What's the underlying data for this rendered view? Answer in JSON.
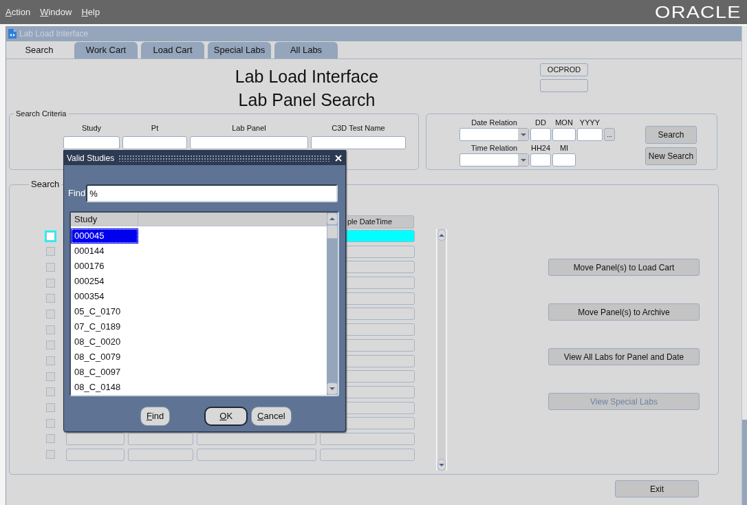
{
  "menu": [
    {
      "label": "Action"
    },
    {
      "label": "Window"
    },
    {
      "label": "Help"
    }
  ],
  "brand": "ORACLE",
  "window": {
    "title": "Lab Load Interface",
    "active": false
  },
  "tabs": [
    {
      "label": "Search",
      "selected": true
    },
    {
      "label": "Work Cart",
      "selected": false
    },
    {
      "label": "Load Cart",
      "selected": false
    },
    {
      "label": "Special Labs",
      "selected": false
    },
    {
      "label": "All Labs",
      "selected": false
    }
  ],
  "heading": [
    "Lab Load Interface",
    "Lab Panel Search"
  ],
  "instance_field": {
    "value": "OCPROD"
  },
  "search_criteria": {
    "title": "Search Criteria",
    "labels": [
      "Study",
      "Pt",
      "Lab Panel",
      "C3D Test Name"
    ]
  },
  "date_filters": {
    "date_relation_label": "Date Relation",
    "date_labels": [
      "DD",
      "MON",
      "YYYY"
    ],
    "lov_button": "...",
    "time_relation_label": "Time Relation",
    "time_labels": [
      "HH24",
      "MI"
    ]
  },
  "search_buttons": [
    "Search",
    "New Search"
  ],
  "results": {
    "title": "Search",
    "visible_header": "ple DateTime",
    "rows": [
      {
        "checked": false,
        "current": true
      },
      {
        "checked": false,
        "current": false
      },
      {
        "checked": false,
        "current": false
      },
      {
        "checked": false,
        "current": false
      },
      {
        "checked": false,
        "current": false
      },
      {
        "checked": false,
        "current": false
      },
      {
        "checked": false,
        "current": false
      },
      {
        "checked": false,
        "current": false
      },
      {
        "checked": false,
        "current": false
      },
      {
        "checked": false,
        "current": false
      },
      {
        "checked": false,
        "current": false
      },
      {
        "checked": false,
        "current": false
      },
      {
        "checked": false,
        "current": false
      },
      {
        "checked": false,
        "current": false
      },
      {
        "checked": false,
        "current": false
      }
    ]
  },
  "actions": [
    {
      "label": "Move Panel(s) to Load Cart",
      "disabled": false
    },
    {
      "label": "Move Panel(s) to Archive",
      "disabled": false
    },
    {
      "label": "View All Labs for Panel and Date",
      "disabled": false
    },
    {
      "label": "View Special Labs",
      "disabled": true
    }
  ],
  "exit_button": "Exit",
  "dialog": {
    "title": "Valid Studies",
    "find_label": "Find",
    "find_value": "%",
    "list_header": "Study",
    "items": [
      {
        "label": "000045",
        "selected": true
      },
      {
        "label": "000144",
        "selected": false
      },
      {
        "label": "000176",
        "selected": false
      },
      {
        "label": "000254",
        "selected": false
      },
      {
        "label": "000354",
        "selected": false
      },
      {
        "label": "05_C_0170",
        "selected": false
      },
      {
        "label": "07_C_0189",
        "selected": false
      },
      {
        "label": "08_C_0020",
        "selected": false
      },
      {
        "label": "08_C_0079",
        "selected": false
      },
      {
        "label": "08_C_0097",
        "selected": false
      },
      {
        "label": "08_C_0148",
        "selected": false
      }
    ],
    "buttons": [
      {
        "label": "Find",
        "default": false
      },
      {
        "label": "OK",
        "default": true
      },
      {
        "label": "Cancel",
        "default": false
      }
    ]
  }
}
